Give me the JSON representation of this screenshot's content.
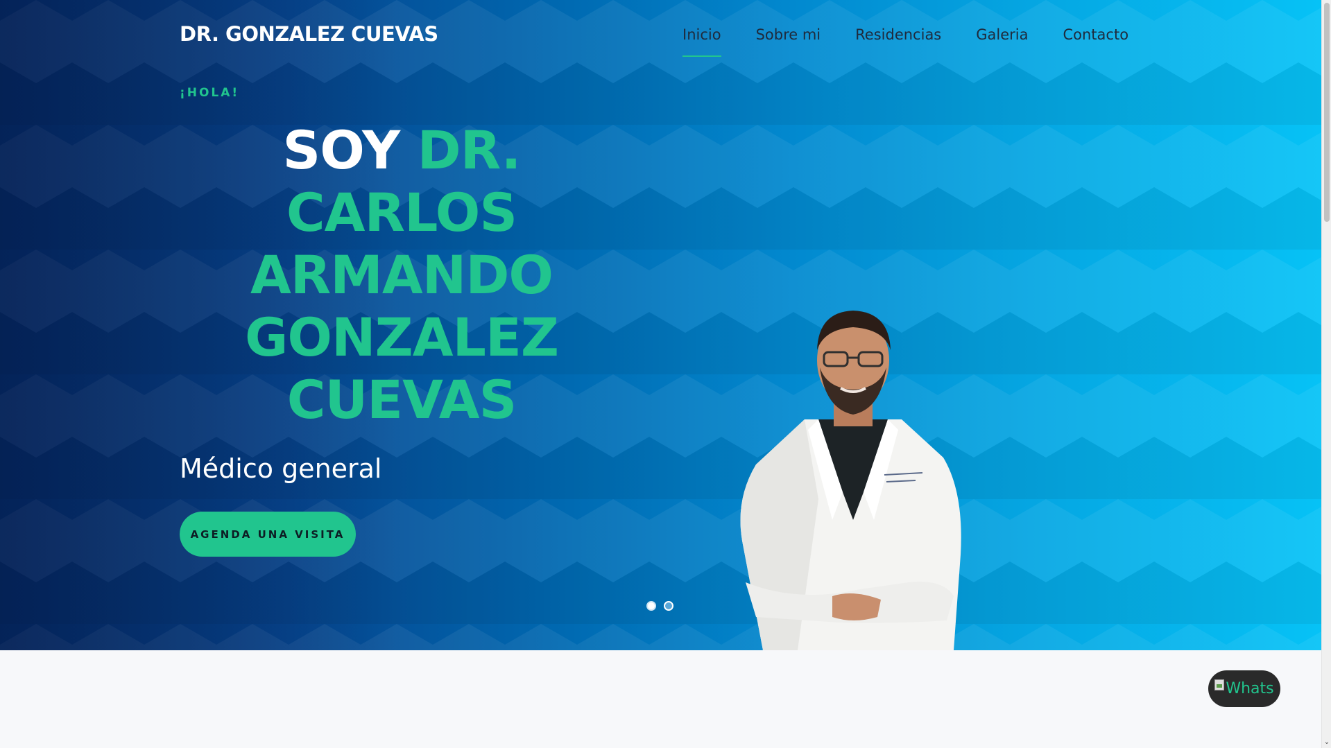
{
  "header": {
    "brand": "DR. GONZALEZ CUEVAS",
    "nav": [
      {
        "label": "Inicio",
        "active": true
      },
      {
        "label": "Sobre mi",
        "active": false
      },
      {
        "label": "Residencias",
        "active": false
      },
      {
        "label": "Galeria",
        "active": false
      },
      {
        "label": "Contacto",
        "active": false
      }
    ]
  },
  "hero": {
    "greeting": "¡HOLA!",
    "headline_prefix": "SOY",
    "headline_name_lines": [
      "DR.",
      "CARLOS",
      "ARMANDO",
      "GONZALEZ",
      "CUEVAS"
    ],
    "subtitle": "Médico general",
    "cta_label": "AGENDA UNA VISITA",
    "carousel": {
      "slides": 2,
      "current": 1
    }
  },
  "floating": {
    "whatsapp_alt": "Whats"
  },
  "colors": {
    "accent": "#21c58e",
    "hero_dark": "#062a66",
    "hero_light": "#06c2f6",
    "nav_text": "#1f2a3c"
  },
  "icons": {
    "whatsapp": "broken-image-icon",
    "scroll_down": "chevron-down-icon"
  }
}
